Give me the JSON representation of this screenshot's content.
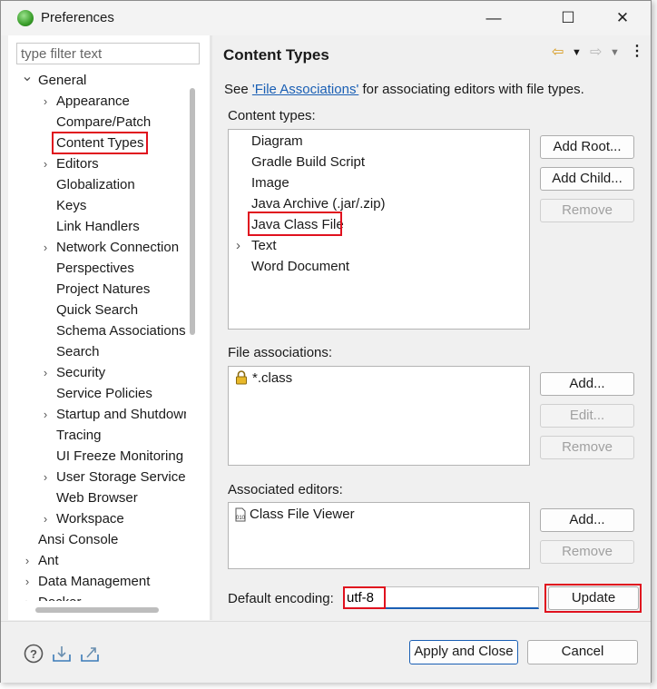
{
  "window": {
    "title": "Preferences"
  },
  "titlebar": {
    "minimize": "—",
    "maximize": "☐",
    "close": "✕"
  },
  "filter": {
    "placeholder": "type filter text"
  },
  "tree": [
    {
      "label": "General",
      "level": 0,
      "expanded": true
    },
    {
      "label": "Appearance",
      "level": 1,
      "expandable": true
    },
    {
      "label": "Compare/Patch",
      "level": 1
    },
    {
      "label": "Content Types",
      "level": 1,
      "selected": true
    },
    {
      "label": "Editors",
      "level": 1,
      "expandable": true
    },
    {
      "label": "Globalization",
      "level": 1
    },
    {
      "label": "Keys",
      "level": 1
    },
    {
      "label": "Link Handlers",
      "level": 1
    },
    {
      "label": "Network Connection",
      "level": 1,
      "expandable": true
    },
    {
      "label": "Perspectives",
      "level": 1
    },
    {
      "label": "Project Natures",
      "level": 1
    },
    {
      "label": "Quick Search",
      "level": 1
    },
    {
      "label": "Schema Associations",
      "level": 1
    },
    {
      "label": "Search",
      "level": 1
    },
    {
      "label": "Security",
      "level": 1,
      "expandable": true
    },
    {
      "label": "Service Policies",
      "level": 1
    },
    {
      "label": "Startup and Shutdown",
      "level": 1,
      "expandable": true
    },
    {
      "label": "Tracing",
      "level": 1
    },
    {
      "label": "UI Freeze Monitoring",
      "level": 1
    },
    {
      "label": "User Storage Service",
      "level": 1,
      "expandable": true
    },
    {
      "label": "Web Browser",
      "level": 1
    },
    {
      "label": "Workspace",
      "level": 1,
      "expandable": true
    },
    {
      "label": "Ansi Console",
      "level": 0
    },
    {
      "label": "Ant",
      "level": 0,
      "expandable": true
    },
    {
      "label": "Data Management",
      "level": 0,
      "expandable": true
    },
    {
      "label": "Docker",
      "level": 0,
      "expandable": true
    }
  ],
  "page": {
    "title": "Content Types",
    "see_prefix": "See ",
    "see_link": "'File Associations'",
    "see_suffix": " for associating editors with file types.",
    "content_types_label": "Content types:",
    "content_types": [
      {
        "label": "Diagram"
      },
      {
        "label": "Gradle Build Script"
      },
      {
        "label": "Image"
      },
      {
        "label": "Java Archive (.jar/.zip)"
      },
      {
        "label": "Java Class File",
        "selected": true
      },
      {
        "label": "Text",
        "expandable": true
      },
      {
        "label": "Word Document"
      }
    ],
    "add_root": "Add Root...",
    "add_child": "Add Child...",
    "remove": "Remove",
    "file_associations_label": "File associations:",
    "file_associations": [
      {
        "label": "*.class",
        "icon": "lock-icon"
      }
    ],
    "assoc_add": "Add...",
    "assoc_edit": "Edit...",
    "assoc_remove": "Remove",
    "associated_editors_label": "Associated editors:",
    "associated_editors": [
      {
        "label": "Class File Viewer",
        "icon": "class-file-icon"
      }
    ],
    "editors_add": "Add...",
    "editors_remove": "Remove",
    "default_encoding_label": "Default encoding:",
    "default_encoding_value": "utf-8",
    "update": "Update"
  },
  "footer": {
    "apply_close": "Apply and Close",
    "cancel": "Cancel"
  },
  "colors": {
    "highlight": "#e0111e",
    "link": "#1a5fb4",
    "accent": "#1a5fb4"
  }
}
